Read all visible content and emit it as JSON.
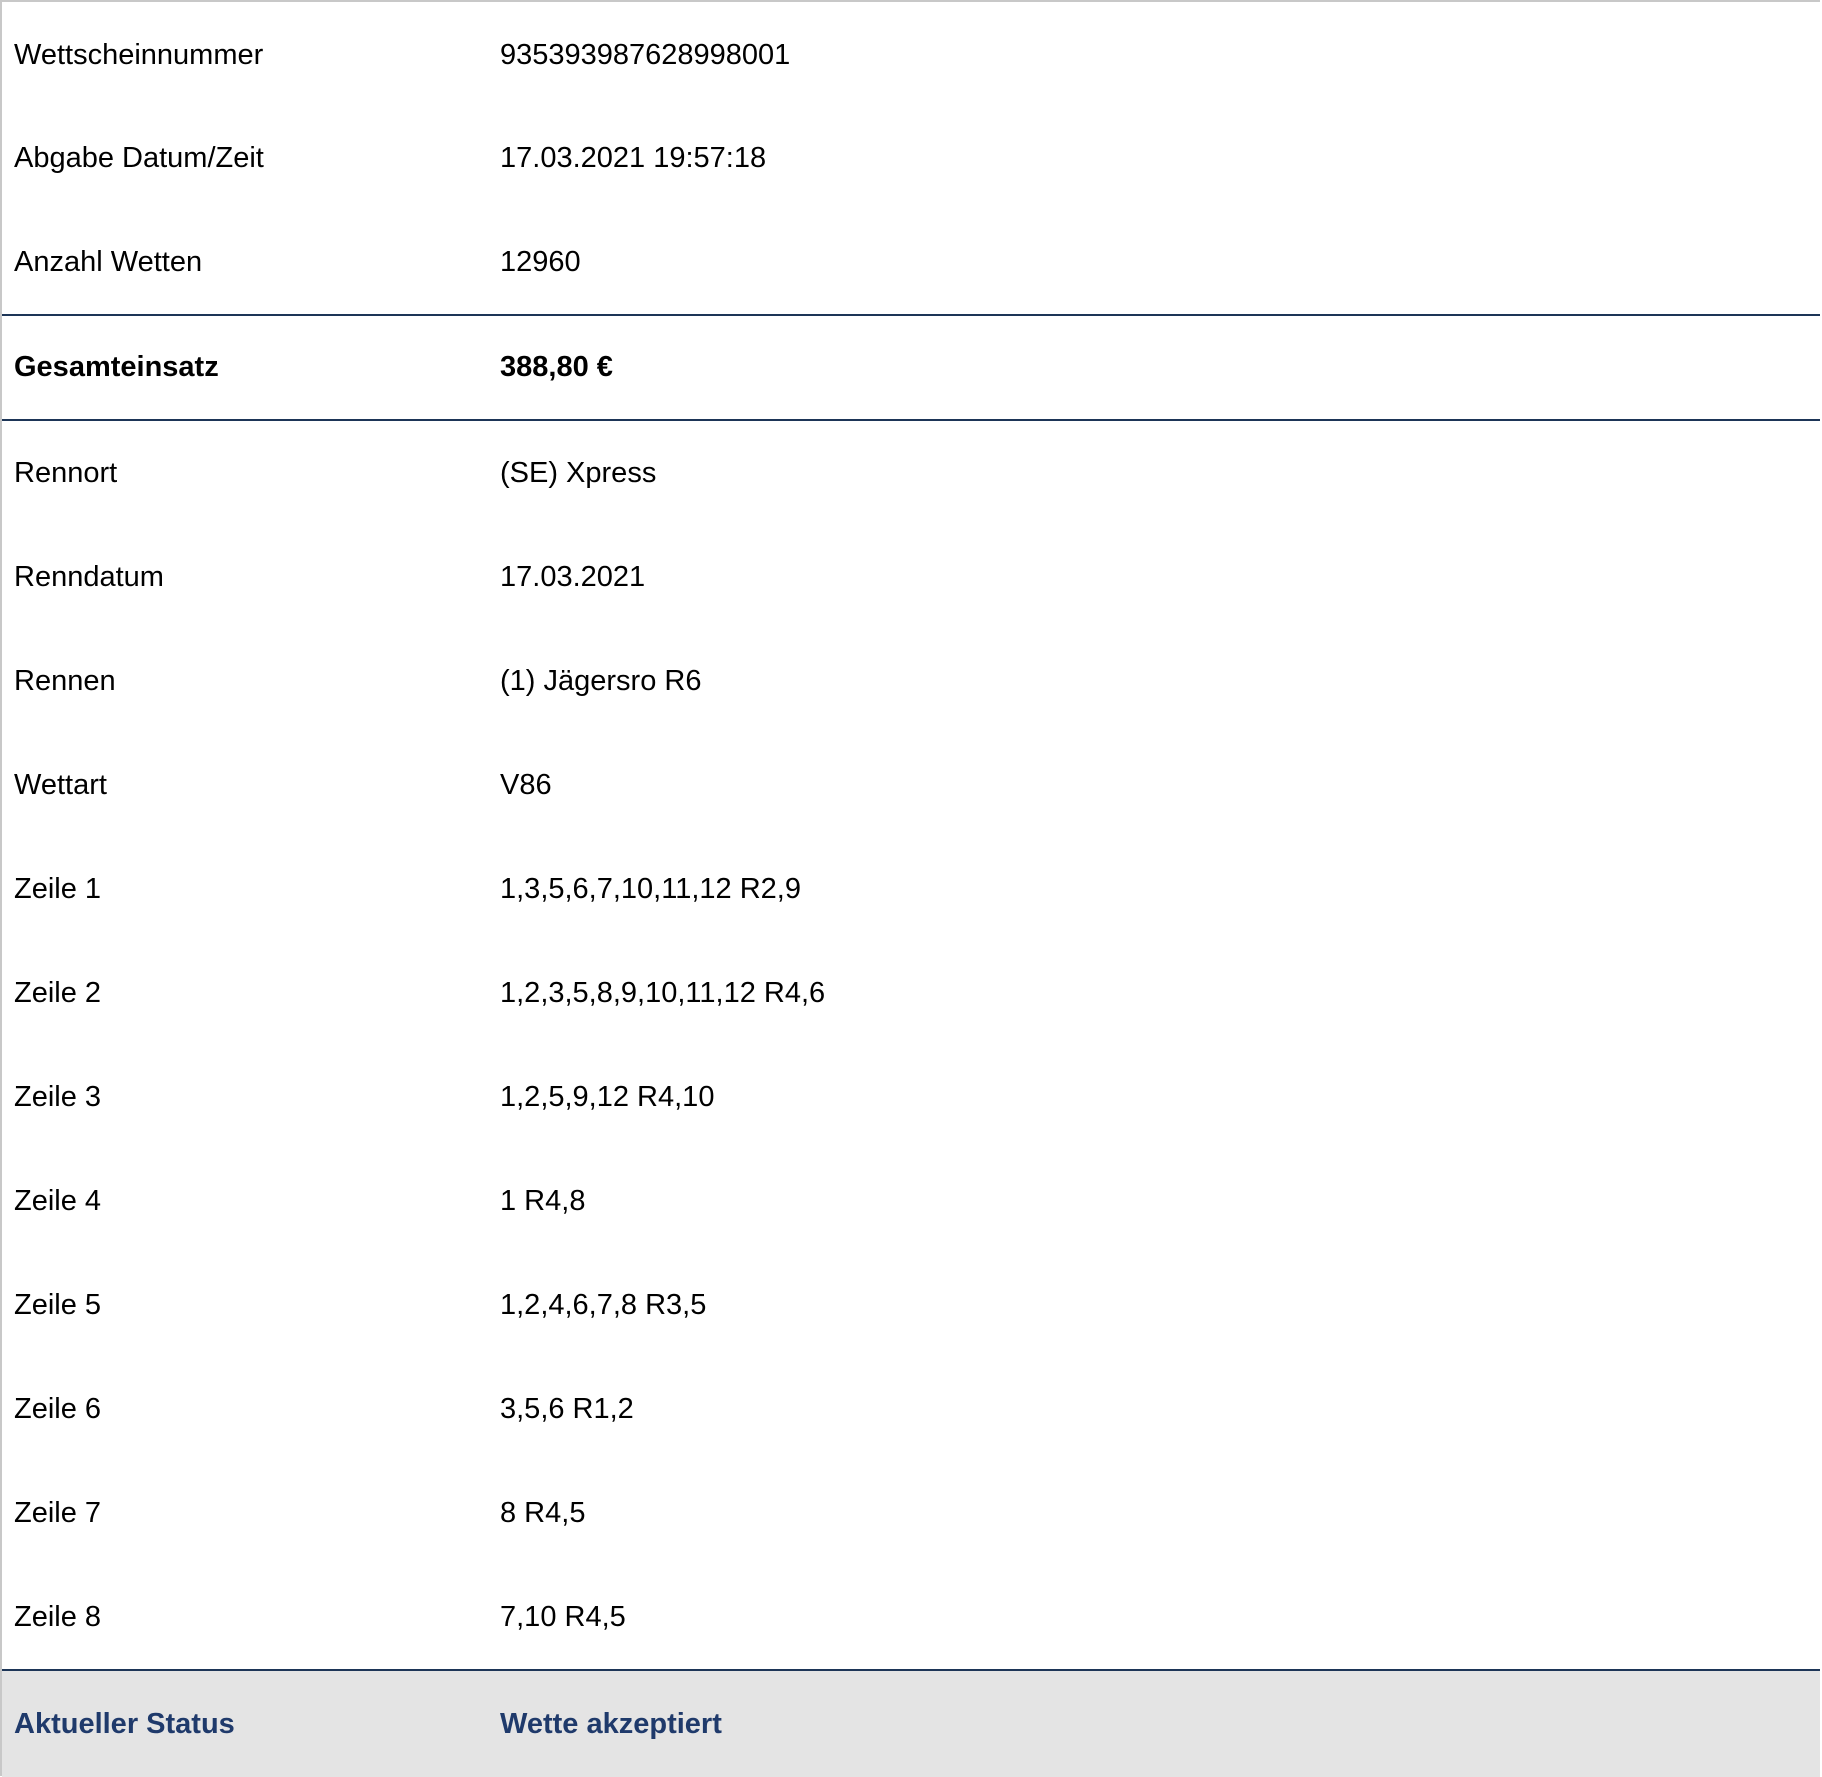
{
  "ticket": {
    "rows_top": [
      {
        "label": "Wettscheinnummer",
        "value": "935393987628998001"
      },
      {
        "label": "Abgabe Datum/Zeit",
        "value": "17.03.2021 19:57:18"
      },
      {
        "label": "Anzahl Wetten",
        "value": "12960"
      }
    ],
    "total": {
      "label": "Gesamteinsatz",
      "value": "388,80 €"
    },
    "rows_detail": [
      {
        "label": "Rennort",
        "value": "(SE) Xpress"
      },
      {
        "label": "Renndatum",
        "value": "17.03.2021"
      },
      {
        "label": "Rennen",
        "value": "(1) Jägersro R6"
      },
      {
        "label": "Wettart",
        "value": "V86"
      },
      {
        "label": "Zeile 1",
        "value": "1,3,5,6,7,10,11,12 R2,9"
      },
      {
        "label": "Zeile 2",
        "value": "1,2,3,5,8,9,10,11,12 R4,6"
      },
      {
        "label": "Zeile 3",
        "value": "1,2,5,9,12 R4,10"
      },
      {
        "label": "Zeile 4",
        "value": "1 R4,8"
      },
      {
        "label": "Zeile 5",
        "value": "1,2,4,6,7,8 R3,5"
      },
      {
        "label": "Zeile 6",
        "value": "3,5,6 R1,2"
      },
      {
        "label": "Zeile 7",
        "value": "8 R4,5"
      },
      {
        "label": "Zeile 8",
        "value": "7,10 R4,5"
      }
    ],
    "status": {
      "label": "Aktueller Status",
      "value": "Wette akzeptiert"
    }
  },
  "colors": {
    "divider": "#1d3557",
    "status_text": "#1f3a6b",
    "status_background": "#e4e4e4"
  }
}
